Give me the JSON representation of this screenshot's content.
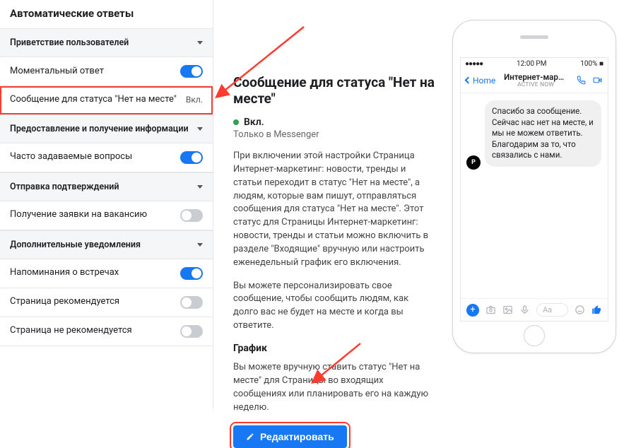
{
  "sidebar": {
    "title": "Автоматические ответы",
    "sections": [
      {
        "header": "Приветствие пользователей",
        "rows": [
          {
            "label": "Моментальный ответ",
            "toggle": "on"
          },
          {
            "label": "Сообщение для статуса \"Нет на месте\"",
            "state": "Вкл.",
            "selected": true
          }
        ]
      },
      {
        "header": "Предоставление и получение информации",
        "rows": [
          {
            "label": "Часто задаваемые вопросы",
            "toggle": "on"
          }
        ]
      },
      {
        "header": "Отправка подтверждений",
        "rows": [
          {
            "label": "Получение заявки на вакансию",
            "toggle": "off"
          }
        ]
      },
      {
        "header": "Дополнительные уведомления",
        "rows": [
          {
            "label": "Напоминания о встречах",
            "toggle": "on"
          },
          {
            "label": "Страница рекомендуется",
            "toggle": "off"
          },
          {
            "label": "Страница не рекомендуется",
            "toggle": "off"
          }
        ]
      }
    ]
  },
  "main": {
    "heading": "Сообщение для статуса \"Нет на месте\"",
    "status_label": "Вкл.",
    "subtext": "Только в Messenger",
    "para1": "При включении этой настройки Страница Интернет-маркетинг: новости, тренды и статьи переходит в статус \"Нет на месте\", а людям, которые вам пишут, отправляться сообщения для статуса \"Нет на месте\". Этот статус для Страницы Интернет-маркетинг: новости, тренды и статьи можно включить в разделе \"Входящие\" вручную или настроить еженедельный график его включения.",
    "para2": "Вы можете персонализировать свое сообщение, чтобы сообщить людям, как долго вас не будет на месте и когда вы ответите.",
    "schedule_heading": "График",
    "schedule_text": "Вы можете вручную ставить статус \"Нет на месте\" для Страницы во входящих сообщениях или планировать его на каждую неделю.",
    "edit_label": "Редактировать"
  },
  "phone": {
    "status": {
      "time": "12:00 PM",
      "carrier_dots": "●●●●●",
      "wifi": "wifi",
      "battery_text": "100%"
    },
    "header": {
      "back": "Home",
      "title": "Интернет-марке...",
      "subtitle": "active now"
    },
    "message": "Спасибо за сообщение. Сейчас нас нет на месте, и мы не можем ответить. Благодарим за то, что связались с нами.",
    "avatar_letter": "P",
    "input_placeholder": "Aa"
  }
}
